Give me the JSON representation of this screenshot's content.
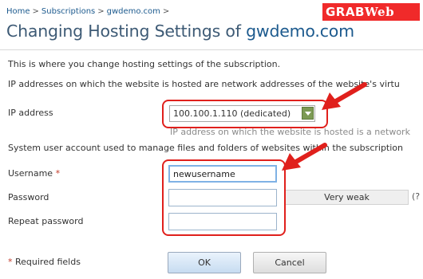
{
  "breadcrumb": {
    "items": [
      "Home",
      "Subscriptions",
      "gwdemo.com"
    ],
    "separator": ">"
  },
  "page": {
    "title_prefix": "Changing Hosting Settings of ",
    "title_domain": "gwdemo.com"
  },
  "watermark": {
    "part1": "GRAB",
    "part2": "Web"
  },
  "intro": "This is where you change hosting settings of the subscription.",
  "ip_section": {
    "description": "IP addresses on which the website is hosted are network addresses of the website's virtu",
    "label": "IP address",
    "selected_value": "100.100.1.110 (dedicated)",
    "hint": "IP address on which the website is hosted is a network"
  },
  "account_section": {
    "description": "System user account used to manage files and folders of websites within the subscription",
    "username_label": "Username",
    "required_mark": "*",
    "username_value": "newusername",
    "password_label": "Password",
    "password_value": "",
    "strength_label": "Very weak",
    "help_mark": "(?",
    "repeat_label": "Repeat password",
    "repeat_value": ""
  },
  "footer": {
    "required_note": "Required fields",
    "required_mark": "*",
    "ok_label": "OK",
    "cancel_label": "Cancel"
  },
  "colors": {
    "annotation_red": "#e0201c",
    "link_blue": "#1c5a8e",
    "select_arrow_green": "#7c9a54"
  }
}
